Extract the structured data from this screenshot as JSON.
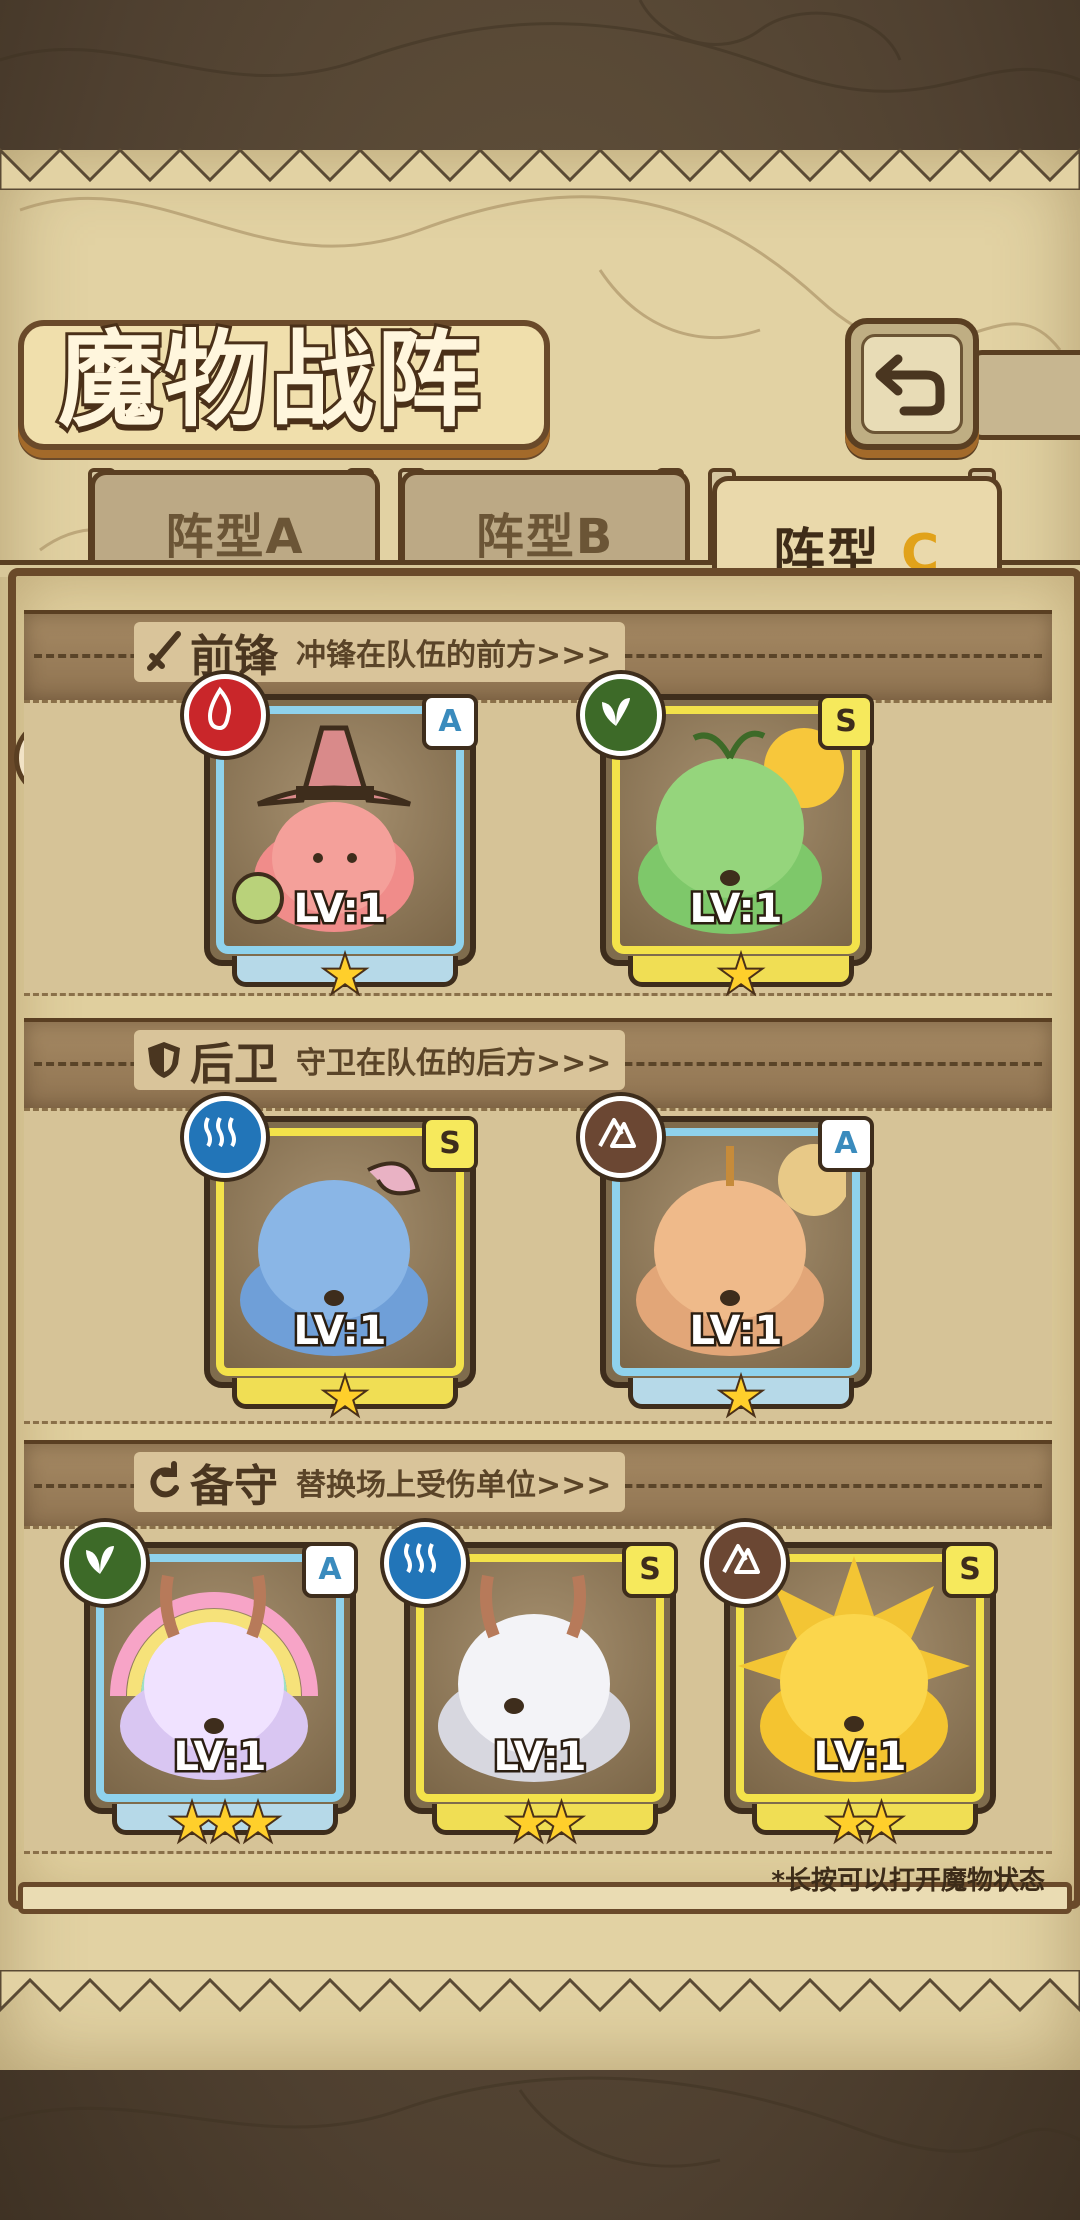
{
  "header": {
    "title": "魔物战阵",
    "back_icon": "return-arrow-icon"
  },
  "tabs": [
    {
      "label": "阵型A",
      "active": false
    },
    {
      "label": "阵型B",
      "active": false
    },
    {
      "label": "阵型",
      "accent": "C",
      "active": true
    }
  ],
  "sections": {
    "front": {
      "title": "前锋",
      "desc": "冲锋在队伍的前方>>>",
      "icon": "sword-icon"
    },
    "back": {
      "title": "后卫",
      "desc": "守卫在队伍的后方>>>",
      "icon": "shield-icon"
    },
    "reserve": {
      "title": "备守",
      "desc": "替换场上受伤单位>>>",
      "icon": "swap-icon"
    }
  },
  "cards": {
    "front": [
      {
        "grade": "A",
        "element": "fire-icon",
        "level": "LV:1",
        "stars": 1
      },
      {
        "grade": "S",
        "element": "leaf-icon",
        "level": "LV:1",
        "stars": 1
      }
    ],
    "back": [
      {
        "grade": "S",
        "element": "water-icon",
        "level": "LV:1",
        "stars": 1
      },
      {
        "grade": "A",
        "element": "earth-icon",
        "level": "LV:1",
        "stars": 1
      }
    ],
    "reserve": [
      {
        "grade": "A",
        "element": "leaf-icon",
        "level": "LV:1",
        "stars": 3
      },
      {
        "grade": "S",
        "element": "water-icon",
        "level": "LV:1",
        "stars": 2
      },
      {
        "grade": "S",
        "element": "earth-icon",
        "level": "LV:1",
        "stars": 2
      }
    ]
  },
  "hint": "*长按可以打开魔物状态",
  "colors": {
    "parchment": "#e2d2a3",
    "frame_brown": "#6a4a2a",
    "grade_a_rim": "#8fd2ec",
    "grade_s_rim": "#f3e24a",
    "star": "#ffcf2b",
    "accent_c": "#e1a21a"
  }
}
